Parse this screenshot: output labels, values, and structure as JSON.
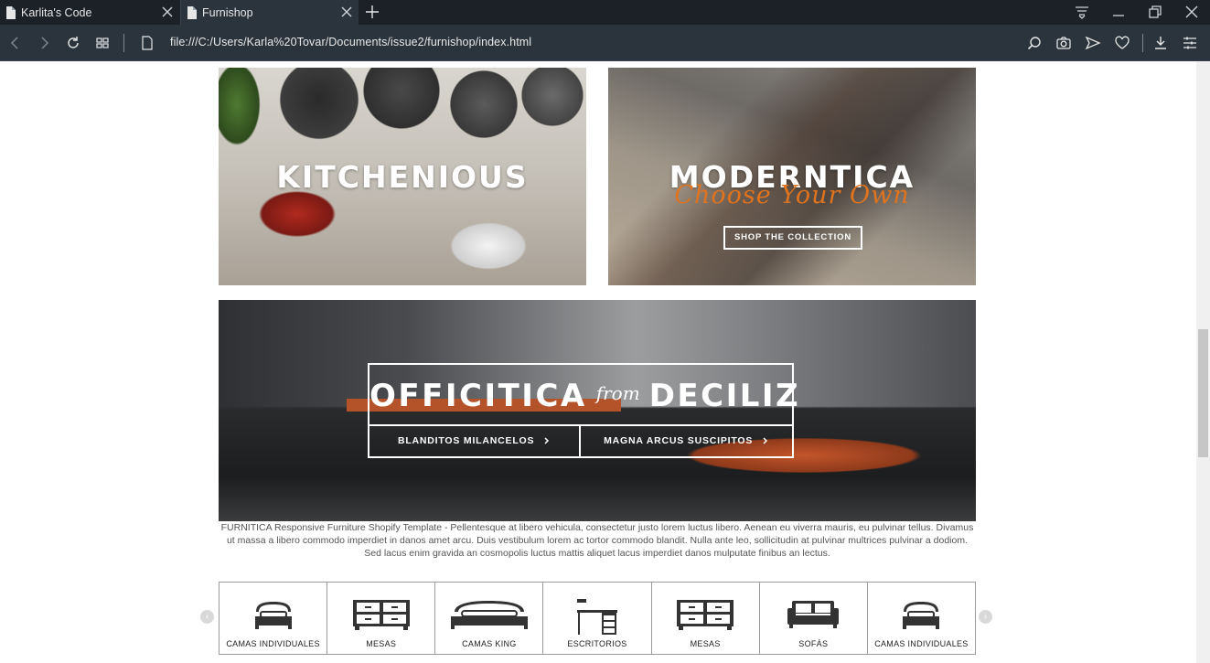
{
  "browser": {
    "tabs": [
      {
        "label": "Karlita's Code",
        "active": false
      },
      {
        "label": "Furnishop",
        "active": true
      }
    ],
    "url": "file:///C:/Users/Karla%20Tovar/Documents/issue2/furnishop/index.html",
    "icons": [
      "file-icon",
      "close-icon",
      "plus-icon",
      "tab-menu-icon",
      "minimize-icon",
      "restore-icon",
      "back-icon",
      "forward-icon",
      "reload-icon",
      "speed-dial-icon",
      "search-icon",
      "camera-icon",
      "send-icon",
      "heart-icon",
      "download-icon",
      "settings-icon"
    ]
  },
  "banners": {
    "kitchen": {
      "title": "KITCHENIOUS"
    },
    "modern": {
      "title": "MODERNTICA",
      "script": "Choose Your Own",
      "button": "SHOP THE COLLECTION"
    },
    "office": {
      "word1": "OFFICITICA",
      "word2": "from",
      "word3": "DECILIZ",
      "button1": "BLANDITOS MILANCELOS",
      "button2": "MAGNA ARCUS SUSCIPITOS"
    }
  },
  "description": "FURNITICA Responsive Furniture Shopify Template - Pellentesque at libero vehicula, consectetur justo lorem luctus libero. Aenean eu viverra mauris, eu pulvinar tellus. Divamus ut massa a libero commodo imperdiet in danos amet arcu. Duis vestibulum lorem ac tortor commodo blandit. Nulla ante leo, sollicitudin at pulvinar multrices pulvinar a dodiom. Sed lacus enim gravida an cosmopolis luctus mattis aliquet lacus imperdiet danos mulputate finibus an lectus.",
  "categories": [
    {
      "label": "CAMAS INDIVIDUALES",
      "icon": "single-bed-icon"
    },
    {
      "label": "MESAS",
      "icon": "dresser-icon"
    },
    {
      "label": "CAMAS KING",
      "icon": "king-bed-icon"
    },
    {
      "label": "ESCRITORIOS",
      "icon": "desk-icon"
    },
    {
      "label": "MESAS",
      "icon": "dresser-icon"
    },
    {
      "label": "SOFÁS",
      "icon": "sofa-icon"
    },
    {
      "label": "CAMAS INDIVIDUALES",
      "icon": "single-bed-icon"
    }
  ],
  "carousel": {
    "prev": "‹",
    "next": "›"
  }
}
